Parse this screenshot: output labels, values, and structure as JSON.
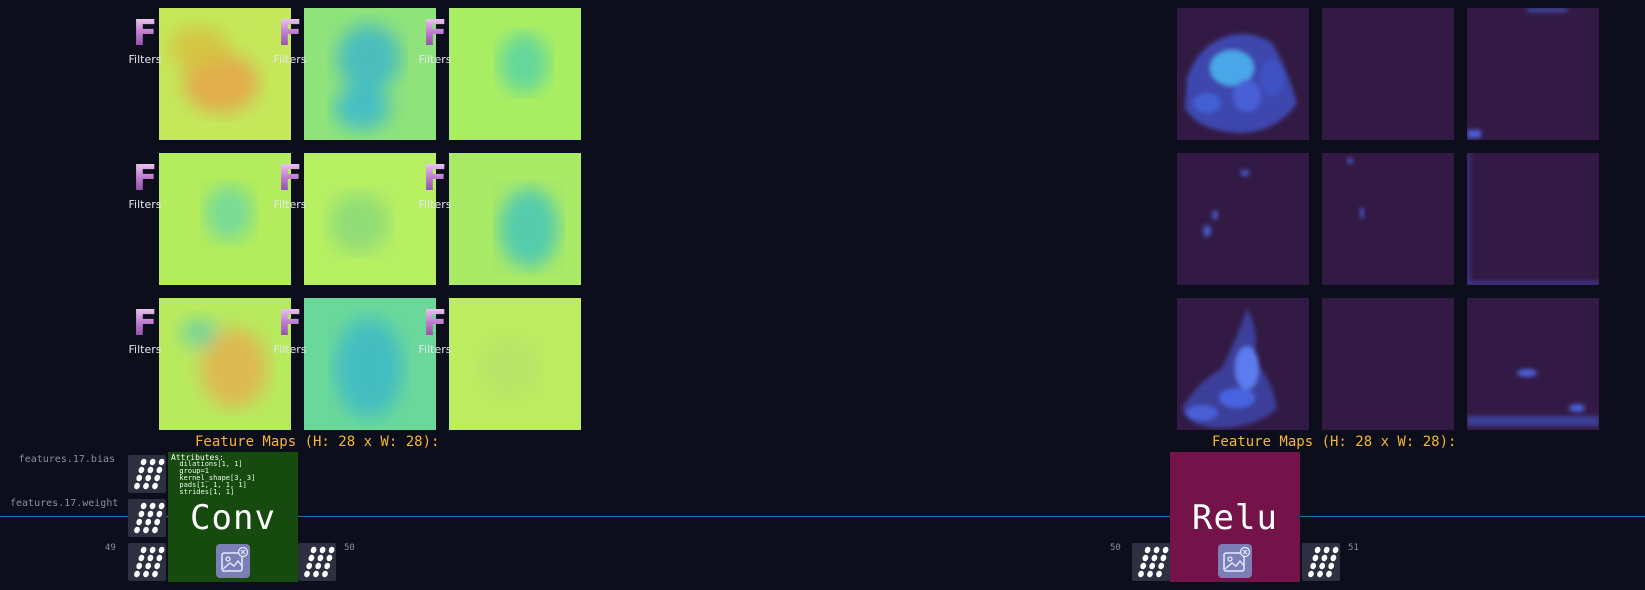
{
  "filters_label": "Filters",
  "filters_letter": "F",
  "left_panel": {
    "caption": "Feature Maps (H: 28 x W: 28):",
    "style": "warm-green"
  },
  "right_panel": {
    "caption": "Feature Maps (H: 28 x W: 28):",
    "style": "relu-purple"
  },
  "tensor_labels": {
    "bias": "features.17.bias",
    "weight": "features.17.weight"
  },
  "edge_numbers": {
    "conv_in": "49",
    "conv_out": "50",
    "relu_in": "50",
    "relu_out": "51"
  },
  "conv_node": {
    "title": "Conv",
    "color": "#174a0f",
    "attributes_title": "Attributes:",
    "attributes": [
      "dilations[1, 1]",
      "group=1",
      "kernel_shape[3, 3]",
      "pads[1, 1, 1, 1]",
      "strides[1, 1]"
    ]
  },
  "relu_node": {
    "title": "Relu",
    "color": "#74124a"
  },
  "icons": {
    "tensor": "tensor-grid-icon",
    "image_toggle": "image-off-icon",
    "filters": "filters-f-icon"
  }
}
